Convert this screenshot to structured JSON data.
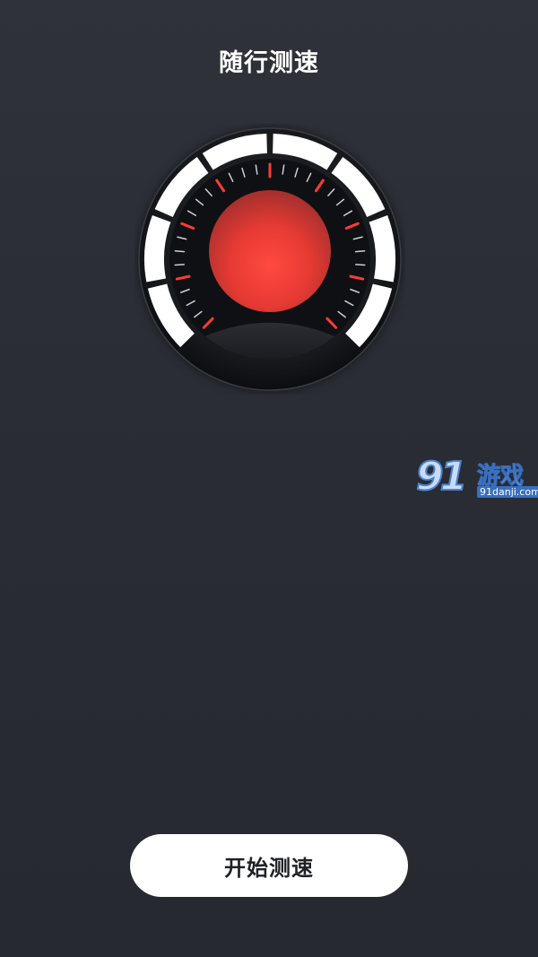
{
  "header": {
    "title": "随行测速"
  },
  "gauge": {
    "colors": {
      "bezel": "#15171b",
      "segment": "#ffffff",
      "tick_red": "#ff3b35",
      "tick_light": "#c9d0dc",
      "center_red": "#f0403a"
    }
  },
  "watermark": {
    "logo": "91",
    "text": "游戏",
    "url": "91danji.com"
  },
  "actions": {
    "start_label": "开始测速"
  }
}
